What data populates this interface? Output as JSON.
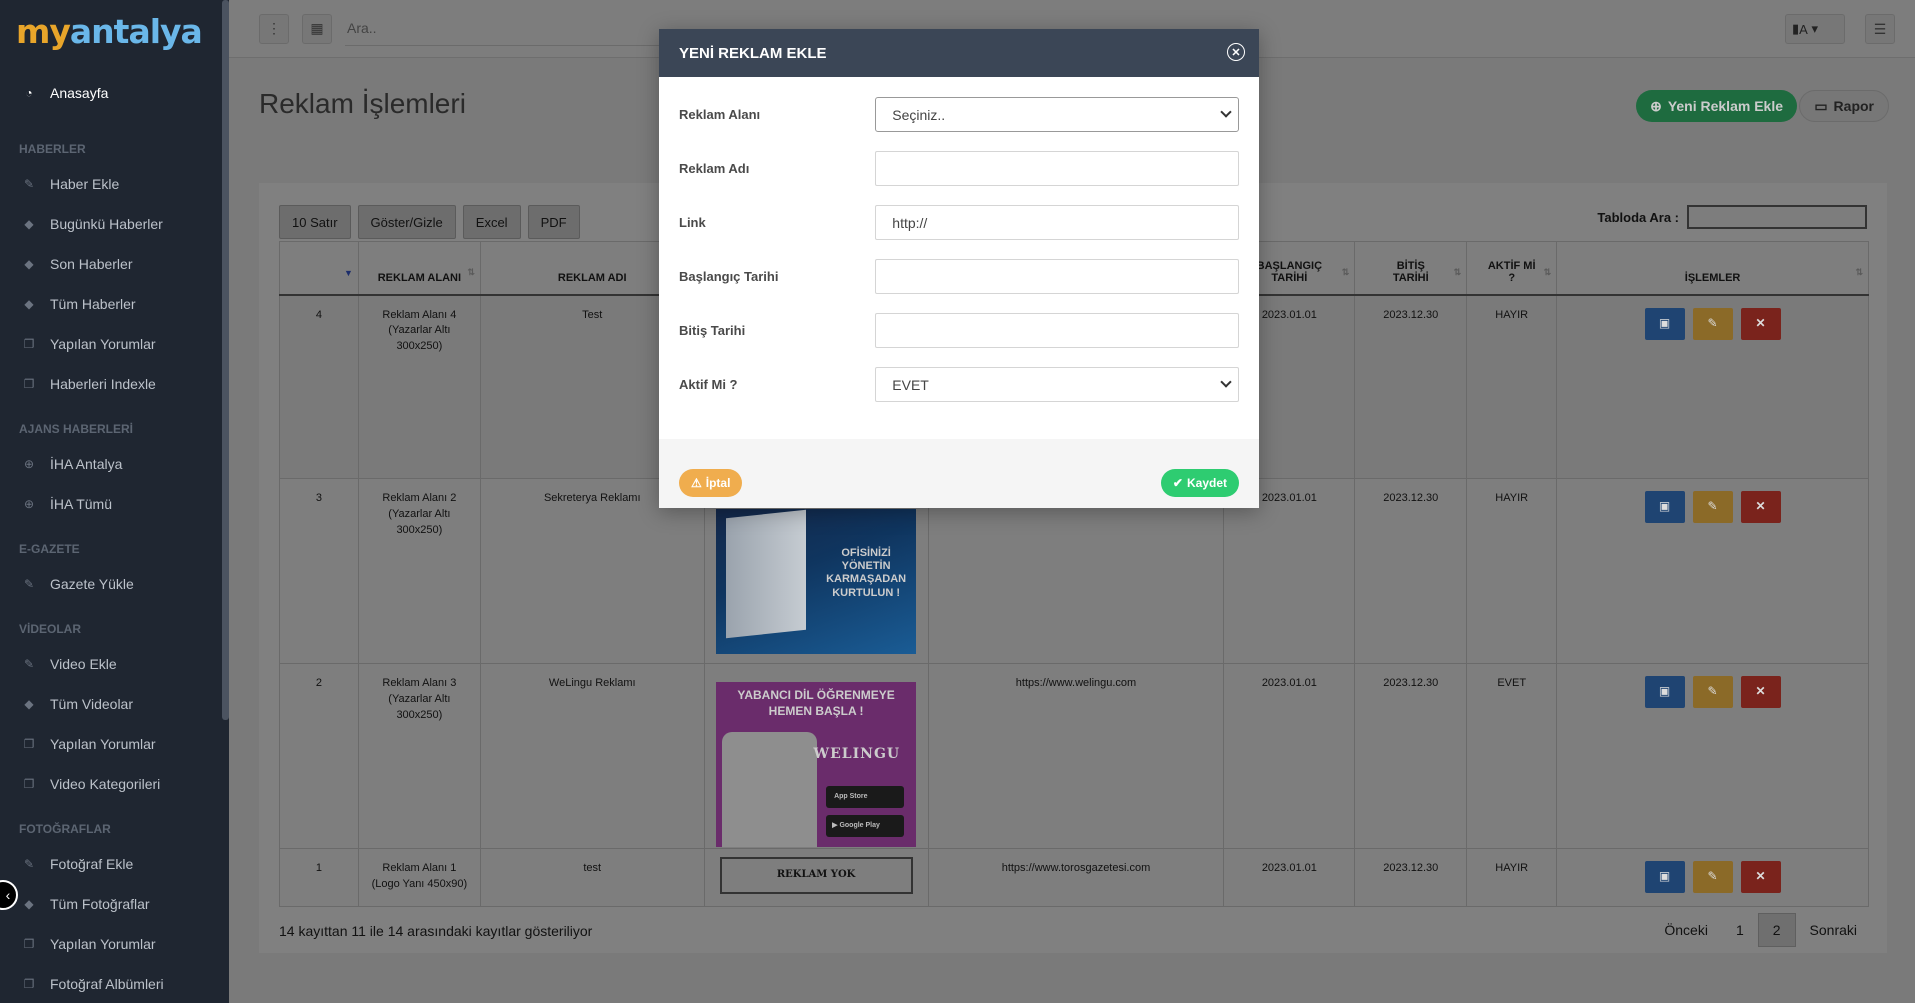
{
  "sidebar": {
    "logo": {
      "part1": "my",
      "part2": "antalya"
    },
    "home": {
      "label": "Anasayfa",
      "icon": "dashboard-icon"
    },
    "sections": [
      {
        "title": "HABERLER",
        "items": [
          {
            "label": "Haber Ekle",
            "icon": "edit-icon"
          },
          {
            "label": "Bugünkü Haberler",
            "icon": "tag-icon"
          },
          {
            "label": "Son Haberler",
            "icon": "tag-icon"
          },
          {
            "label": "Tüm Haberler",
            "icon": "tag-icon"
          },
          {
            "label": "Yapılan Yorumlar",
            "icon": "copy-icon"
          },
          {
            "label": "Haberleri Indexle",
            "icon": "copy-icon"
          }
        ]
      },
      {
        "title": "AJANS HABERLERİ",
        "items": [
          {
            "label": "İHA Antalya",
            "icon": "plus-circle-icon"
          },
          {
            "label": "İHA Tümü",
            "icon": "plus-circle-icon"
          }
        ]
      },
      {
        "title": "E-GAZETE",
        "items": [
          {
            "label": "Gazete Yükle",
            "icon": "edit-icon"
          }
        ]
      },
      {
        "title": "VİDEOLAR",
        "items": [
          {
            "label": "Video Ekle",
            "icon": "edit-icon"
          },
          {
            "label": "Tüm Videolar",
            "icon": "tag-icon"
          },
          {
            "label": "Yapılan Yorumlar",
            "icon": "copy-icon"
          },
          {
            "label": "Video Kategorileri",
            "icon": "copy-icon"
          }
        ]
      },
      {
        "title": "FOTOĞRAFLAR",
        "items": [
          {
            "label": "Fotoğraf Ekle",
            "icon": "edit-icon"
          },
          {
            "label": "Tüm Fotoğraflar",
            "icon": "tag-icon"
          },
          {
            "label": "Yapılan Yorumlar",
            "icon": "copy-icon"
          },
          {
            "label": "Fotoğraf Albümleri",
            "icon": "copy-icon"
          }
        ]
      }
    ]
  },
  "topbar": {
    "search_placeholder": "Ara..",
    "lang_label": "A"
  },
  "page": {
    "title": "Reklam İşlemleri",
    "new_button": "Yeni Reklam Ekle",
    "report_button": "Rapor"
  },
  "table_tools": {
    "buttons": [
      "10 Satır",
      "Göster/Gizle",
      "Excel",
      "PDF"
    ],
    "search_label": "Tabloda Ara :"
  },
  "table": {
    "headers": [
      "",
      "REKLAM ALANI",
      "REKLAM ADI",
      "",
      "",
      "BAŞLANGIÇ TARİHİ",
      "BİTİŞ TARİHİ",
      "AKTİF Mİ ?",
      "İŞLEMLER"
    ],
    "rows": [
      {
        "id": "4",
        "area": "Reklam Alanı 4 (Yazarlar Altı 300x250)",
        "name": "Test",
        "link": "",
        "start": "2023.01.01",
        "end": "2023.12.30",
        "active": "HAYIR"
      },
      {
        "id": "3",
        "area": "Reklam Alanı 2 (Yazarlar Altı 300x250)",
        "name": "Sekreterya Reklamı",
        "link": "",
        "start": "2023.01.01",
        "end": "2023.12.30",
        "active": "HAYIR"
      },
      {
        "id": "2",
        "area": "Reklam Alanı 3 (Yazarlar Altı 300x250)",
        "name": "WeLingu Reklamı",
        "link": "https://www.welingu.com",
        "start": "2023.01.01",
        "end": "2023.12.30",
        "active": "EVET"
      },
      {
        "id": "1",
        "area": "Reklam Alanı 1 (Logo Yanı 450x90)",
        "name": "test",
        "link": "https://www.torosgazetesi.com",
        "start": "2023.01.01",
        "end": "2023.12.30",
        "active": "HAYIR"
      }
    ],
    "ad_sekreterya": {
      "text": "OFİSİNİZİ YÖNETİN KARMAŞADAN KURTULUN !"
    },
    "ad_welingu": {
      "headline": "YABANCI DİL ÖĞRENMEYE HEMEN BAŞLA !",
      "brand": "WELINGU",
      "app_store": "App Store",
      "google_play": "Google Play"
    },
    "no_ad": "REKLAM YOK"
  },
  "footer": {
    "info": "14 kayıttan 11 ile 14 arasındaki kayıtlar gösteriliyor",
    "prev": "Önceki",
    "pages": [
      "1",
      "2"
    ],
    "next": "Sonraki"
  },
  "modal": {
    "title": "YENİ REKLAM EKLE",
    "fields": {
      "area": {
        "label": "Reklam Alanı",
        "value": "Seçiniz.."
      },
      "name": {
        "label": "Reklam Adı",
        "value": ""
      },
      "link": {
        "label": "Link",
        "value": "http://"
      },
      "start": {
        "label": "Başlangıç Tarihi",
        "value": ""
      },
      "end": {
        "label": "Bitiş Tarihi",
        "value": ""
      },
      "active": {
        "label": "Aktif Mi ?",
        "value": "EVET"
      }
    },
    "cancel": "İptal",
    "save": "Kaydet"
  },
  "colors": {
    "sidebar_bg": "#1f2631",
    "modal_header": "#3b4656",
    "success": "#2ecc71",
    "warning": "#f0ad4e"
  }
}
